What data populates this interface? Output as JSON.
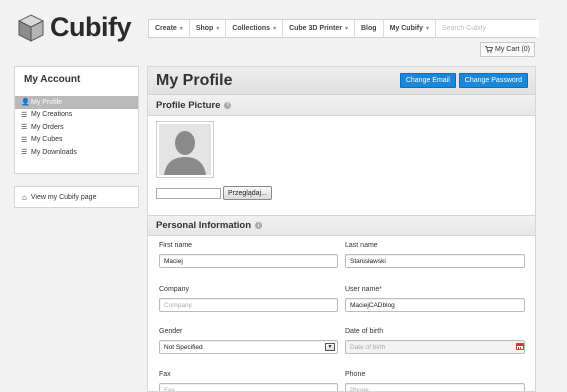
{
  "brand": {
    "name": "Cubify"
  },
  "nav": {
    "items": [
      {
        "label": "Create",
        "caret": "▾"
      },
      {
        "label": "Shop",
        "caret": "▾"
      },
      {
        "label": "Collections",
        "caret": "▾"
      },
      {
        "label": "Cube 3D Printer",
        "caret": "▾"
      },
      {
        "label": "Blog",
        "caret": ""
      },
      {
        "label": "My Cubify",
        "caret": "▾"
      }
    ],
    "search_placeholder": "Search Cubify"
  },
  "cart": {
    "label": "My Cart (0)"
  },
  "sidebar": {
    "title": "My Account",
    "items": [
      {
        "label": "My Profile",
        "icon": "user-icon"
      },
      {
        "label": "My Creations",
        "icon": "list-icon"
      },
      {
        "label": "My Orders",
        "icon": "list-icon"
      },
      {
        "label": "My Cubes",
        "icon": "list-icon"
      },
      {
        "label": "My Downloads",
        "icon": "list-icon"
      }
    ],
    "link_label": "View my Cubify page"
  },
  "main": {
    "title": "My Profile",
    "change_email": "Change Email",
    "change_password": "Change Password",
    "picture_section": "Profile Picture",
    "browse_button": "Przeglądaj...",
    "personal_section": "Personal Information",
    "fields": {
      "first_name": {
        "label": "First name",
        "value": "Maciej"
      },
      "last_name": {
        "label": "Last name",
        "value": "Stanisławski"
      },
      "company": {
        "label": "Company",
        "placeholder": "Company"
      },
      "username": {
        "label": "User name",
        "required": "*",
        "value": "MaciejCADblog"
      },
      "gender": {
        "label": "Gender",
        "value": "Not Specified"
      },
      "dob": {
        "label": "Date of birth",
        "placeholder": "Date of birth"
      },
      "fax": {
        "label": "Fax",
        "placeholder": "Fax"
      },
      "phone": {
        "label": "Phone",
        "placeholder": "Phone"
      }
    }
  },
  "colors": {
    "accent": "#1a87d8",
    "required": "#cc3333",
    "active_side": "#b9b9b9"
  }
}
